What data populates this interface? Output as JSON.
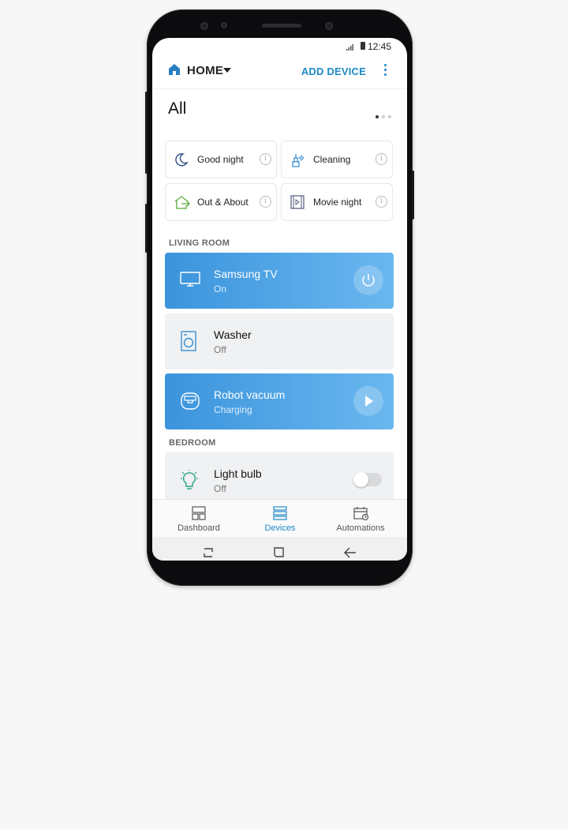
{
  "status_bar": {
    "time": "12:45"
  },
  "header": {
    "location": "HOME",
    "add_device": "ADD DEVICE"
  },
  "scenes_title": "All",
  "scenes": [
    {
      "label": "Good night",
      "icon": "moon-icon"
    },
    {
      "label": "Cleaning",
      "icon": "broom-icon"
    },
    {
      "label": "Out & About",
      "icon": "leave-home-icon"
    },
    {
      "label": "Movie night",
      "icon": "movie-icon"
    }
  ],
  "rooms": {
    "living_room": "LIVING ROOM",
    "bedroom": "BEDROOM"
  },
  "devices": [
    {
      "name": "Samsung TV",
      "status": "On",
      "icon": "tv-icon",
      "active": true,
      "control": "power-icon"
    },
    {
      "name": "Washer",
      "status": "Off",
      "icon": "washer-icon",
      "active": false
    },
    {
      "name": "Robot vacuum",
      "status": "Charging",
      "icon": "robot-vacuum-icon",
      "active": true,
      "control": "play-icon"
    },
    {
      "name": "Light bulb",
      "status": "Off",
      "icon": "light-bulb-icon",
      "active": false,
      "control": "toggle-off"
    }
  ],
  "tabs": [
    {
      "label": "Dashboard",
      "icon": "dashboard-icon"
    },
    {
      "label": "Devices",
      "icon": "devices-icon",
      "selected": true
    },
    {
      "label": "Automations",
      "icon": "automations-icon"
    }
  ],
  "colors": {
    "accent": "#1e88c7",
    "card_active": "#3b94dc",
    "card_idle": "#eff1f3",
    "background": "#f7f7f7"
  }
}
